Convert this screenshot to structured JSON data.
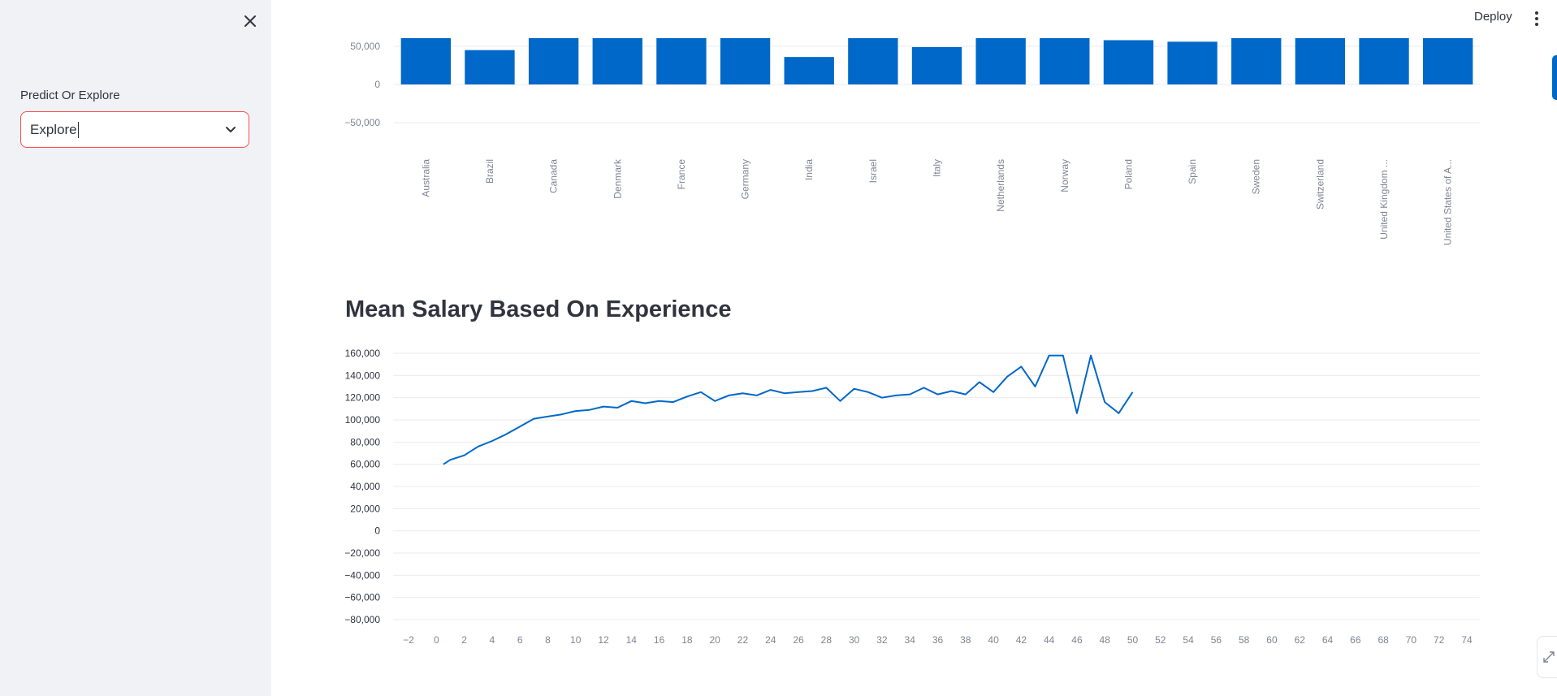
{
  "sidebar": {
    "select_label": "Predict Or Explore",
    "select_value": "Explore",
    "close_icon": "close-icon",
    "chevron_icon": "chevron-down-icon"
  },
  "header": {
    "deploy_label": "Deploy",
    "menu_icon": "vertical-ellipsis-icon"
  },
  "section_title": "Mean Salary Based On Experience",
  "colors": {
    "accent": "#0068c9",
    "error_border": "#ff4b4b",
    "sidebar_bg": "#f0f2f6"
  },
  "chart_data": [
    {
      "type": "bar",
      "title": "",
      "categories": [
        "Australia",
        "Brazil",
        "Canada",
        "Denmark",
        "France",
        "Germany",
        "India",
        "Israel",
        "Italy",
        "Netherlands",
        "Norway",
        "Poland",
        "Spain",
        "Sweden",
        "Switzerland",
        "United Kingdom ...",
        "United States of A..."
      ],
      "values": [
        62000,
        45000,
        62000,
        62000,
        62000,
        62000,
        36000,
        62000,
        49000,
        62000,
        62000,
        58000,
        56000,
        62000,
        62000,
        62000,
        62000
      ],
      "y_ticks": [
        "50,000",
        "0",
        "−50,000"
      ],
      "ylim_visible": [
        -60000,
        62000
      ]
    },
    {
      "type": "line",
      "title": "Mean Salary Based On Experience",
      "x": [
        0.5,
        1,
        2,
        3,
        4,
        5,
        6,
        7,
        8,
        9,
        10,
        11,
        12,
        13,
        14,
        15,
        16,
        17,
        18,
        19,
        20,
        21,
        22,
        23,
        24,
        25,
        26,
        27,
        28,
        29,
        30,
        31,
        32,
        33,
        34,
        35,
        36,
        37,
        38,
        39,
        40,
        41,
        42,
        43,
        44,
        45,
        46,
        47,
        48,
        49,
        50
      ],
      "y": [
        60000,
        64000,
        68000,
        76000,
        81000,
        87000,
        94000,
        101000,
        103000,
        105000,
        108000,
        109000,
        112000,
        111000,
        117000,
        115000,
        117000,
        116000,
        121000,
        125000,
        117000,
        122000,
        124000,
        122000,
        127000,
        124000,
        125000,
        126000,
        129000,
        117000,
        128000,
        125000,
        120000,
        122000,
        123000,
        129000,
        123000,
        126000,
        123000,
        134000,
        125000,
        139000,
        148000,
        130000,
        158000,
        158000,
        106000,
        158000,
        116000,
        106000,
        125000
      ],
      "x_ticks": [
        "−2",
        "0",
        "2",
        "4",
        "6",
        "8",
        "10",
        "12",
        "14",
        "16",
        "18",
        "20",
        "22",
        "24",
        "26",
        "28",
        "30",
        "32",
        "34",
        "36",
        "38",
        "40",
        "42",
        "44",
        "46",
        "48",
        "50",
        "52",
        "54",
        "56",
        "58",
        "60",
        "62",
        "64",
        "66",
        "68",
        "70",
        "72",
        "74"
      ],
      "y_ticks": [
        "160,000",
        "140,000",
        "120,000",
        "100,000",
        "80,000",
        "60,000",
        "40,000",
        "20,000",
        "0",
        "−20,000",
        "−40,000",
        "−60,000",
        "−80,000"
      ],
      "xlim": [
        -3,
        75
      ],
      "ylim": [
        -80000,
        160000
      ],
      "grid": true
    }
  ]
}
